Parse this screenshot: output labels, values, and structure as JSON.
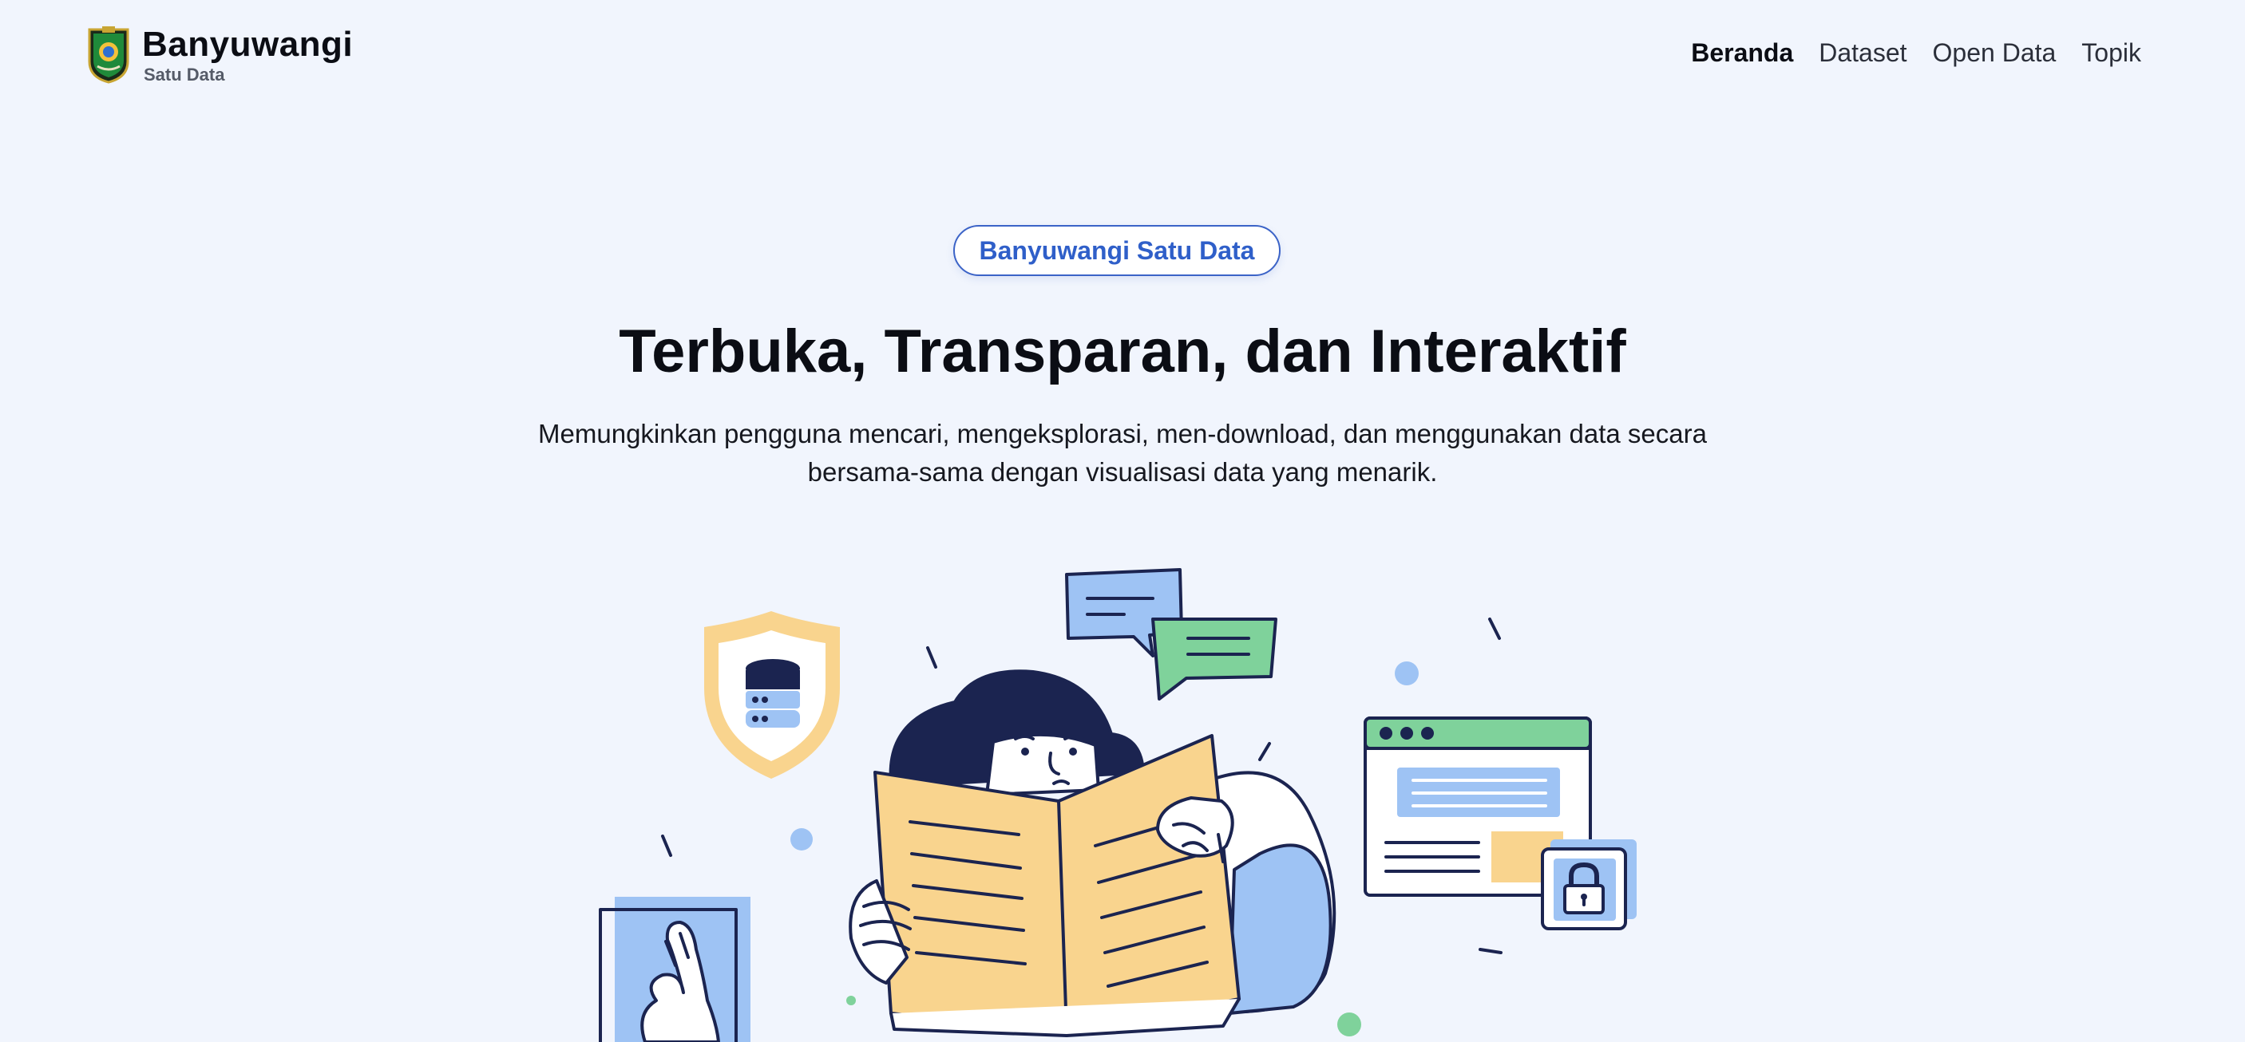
{
  "header": {
    "brand_name": "Banyuwangi",
    "brand_sub": "Satu Data",
    "nav": [
      {
        "label": "Beranda",
        "active": true
      },
      {
        "label": "Dataset",
        "active": false
      },
      {
        "label": "Open Data",
        "active": false
      },
      {
        "label": "Topik",
        "active": false
      }
    ]
  },
  "hero": {
    "badge": "Banyuwangi Satu Data",
    "title": "Terbuka, Transparan, dan Interaktif",
    "description": "Memungkinkan pengguna mencari, mengeksplorasi, men-download, dan menggunakan data secara bersama-sama dengan visualisasi data yang menarik."
  },
  "colors": {
    "background": "#f1f5fd",
    "accent": "#2f5fc9",
    "illustration_yellow": "#f9d48e",
    "illustration_blue": "#9ec3f4",
    "illustration_green": "#7fd29b",
    "illustration_navy": "#1b2450"
  },
  "icons": [
    "regency-emblem-icon",
    "database-shield-icon",
    "chat-bubbles-icon",
    "browser-window-icon",
    "padlock-icon",
    "hand-gesture-icon"
  ]
}
